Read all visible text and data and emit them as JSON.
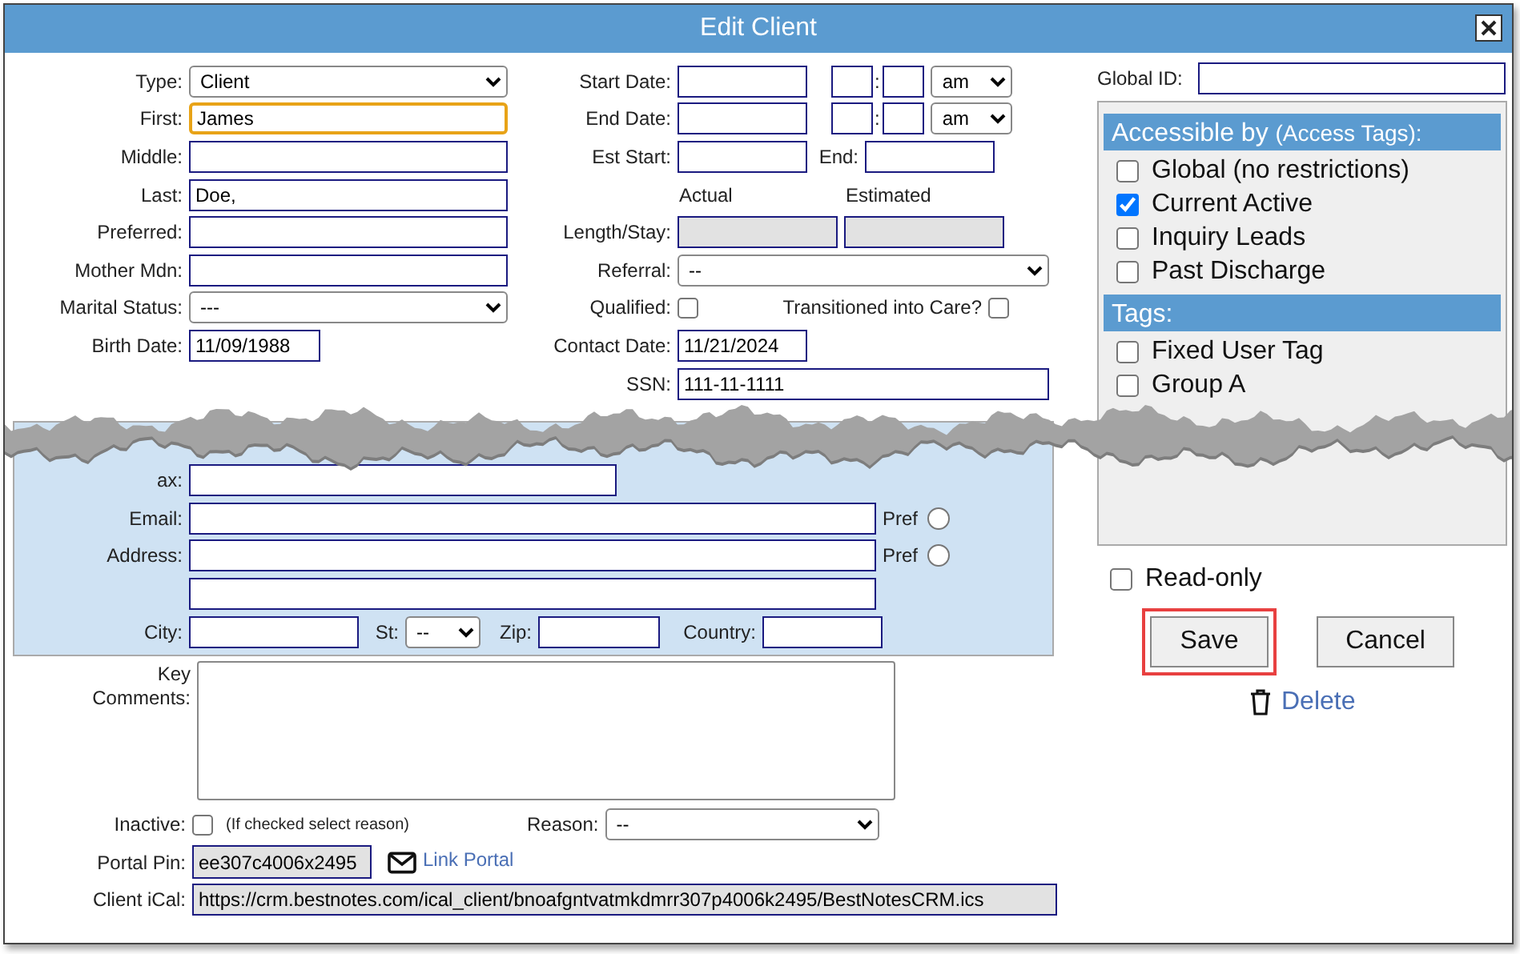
{
  "window": {
    "title": "Edit Client"
  },
  "personal": [
    {
      "kind": "select",
      "label": "Type:",
      "value": "Client",
      "focused": false
    },
    {
      "kind": "text",
      "label": "First:",
      "value": "James",
      "focused": true
    },
    {
      "kind": "text",
      "label": "Middle:",
      "focused": false
    },
    {
      "kind": "text",
      "label": "Last:",
      "value": "Doe,",
      "focused": false
    },
    {
      "kind": "text",
      "label": "Preferred:",
      "focused": false
    },
    {
      "kind": "text",
      "label": "Mother Mdn:",
      "focused": false
    },
    {
      "kind": "select",
      "label": "Marital Status:",
      "value": "---",
      "focused": false
    },
    {
      "kind": "date",
      "label": "Birth Date:",
      "value": "11/09/1988",
      "focused": false
    }
  ],
  "stay": [
    {
      "kind": "datetime",
      "label": "Start Date:",
      "separator": ":",
      "ampm": "am"
    },
    {
      "kind": "datetime",
      "label": "End Date:",
      "separator": ":",
      "ampm": "am"
    },
    {
      "kind": "estimate",
      "label": "Est Start:",
      "end_label": "End:"
    },
    {
      "kind": "headings",
      "headings": [
        "Actual",
        "Estimated"
      ]
    },
    {
      "kind": "readonly_pair",
      "label": "Length/Stay:"
    },
    {
      "kind": "select",
      "label": "Referral:",
      "value": "--"
    },
    {
      "kind": "checks",
      "items": [
        {
          "label": "Qualified:",
          "checked": false
        },
        {
          "label": "Transitioned into Care?",
          "checked": false
        }
      ]
    },
    {
      "kind": "date",
      "label": "Contact Date:",
      "value": "11/21/2024"
    },
    {
      "kind": "wide",
      "label": "SSN:",
      "value": "111-11-1111"
    }
  ],
  "contact": [
    {
      "kind": "short",
      "label": "ax:"
    },
    {
      "kind": "pref",
      "label": "Email:",
      "pref_label": "Pref",
      "pref_selected": false
    },
    {
      "kind": "pref",
      "label": "Address:",
      "pref_label": "Pref",
      "pref_selected": false
    },
    {
      "kind": "line"
    },
    {
      "kind": "place",
      "fields": [
        {
          "label": "City:"
        },
        {
          "label": "St:",
          "select": "--"
        },
        {
          "label": "Zip:"
        },
        {
          "label": "Country:"
        }
      ]
    }
  ],
  "comments": {
    "label": "Key Comments:"
  },
  "inactive": {
    "label": "Inactive:",
    "checked": false,
    "hint": "(If checked select reason)",
    "reason_label": "Reason:",
    "reason": "--"
  },
  "portal": {
    "label": "Portal Pin:",
    "value": "ee307c4006x2495",
    "link": "Link Portal"
  },
  "ical": {
    "label": "Client iCal:",
    "value": "https://crm.bestnotes.com/ical_client/bnoafgntvatmkdmrr307p4006k2495/BestNotesCRM.ics"
  },
  "global_id": {
    "label": "Global ID:"
  },
  "access": {
    "title": "Accessible by",
    "note": "(Access Tags):",
    "items": [
      {
        "label": "Global (no restrictions)",
        "checked": false
      },
      {
        "label": "Current Active",
        "checked": true
      },
      {
        "label": "Inquiry Leads",
        "checked": false
      },
      {
        "label": "Past Discharge",
        "checked": false
      }
    ]
  },
  "tags": {
    "title": "Tags:",
    "items": [
      {
        "label": "Fixed User Tag",
        "checked": false
      },
      {
        "label": "Group A",
        "checked": false
      }
    ]
  },
  "read_only": {
    "label": "Read-only",
    "checked": false
  },
  "buttons": [
    {
      "label": "Save",
      "highlighted": true
    },
    {
      "label": "Cancel",
      "highlighted": false
    }
  ],
  "delete": {
    "label": "Delete"
  }
}
